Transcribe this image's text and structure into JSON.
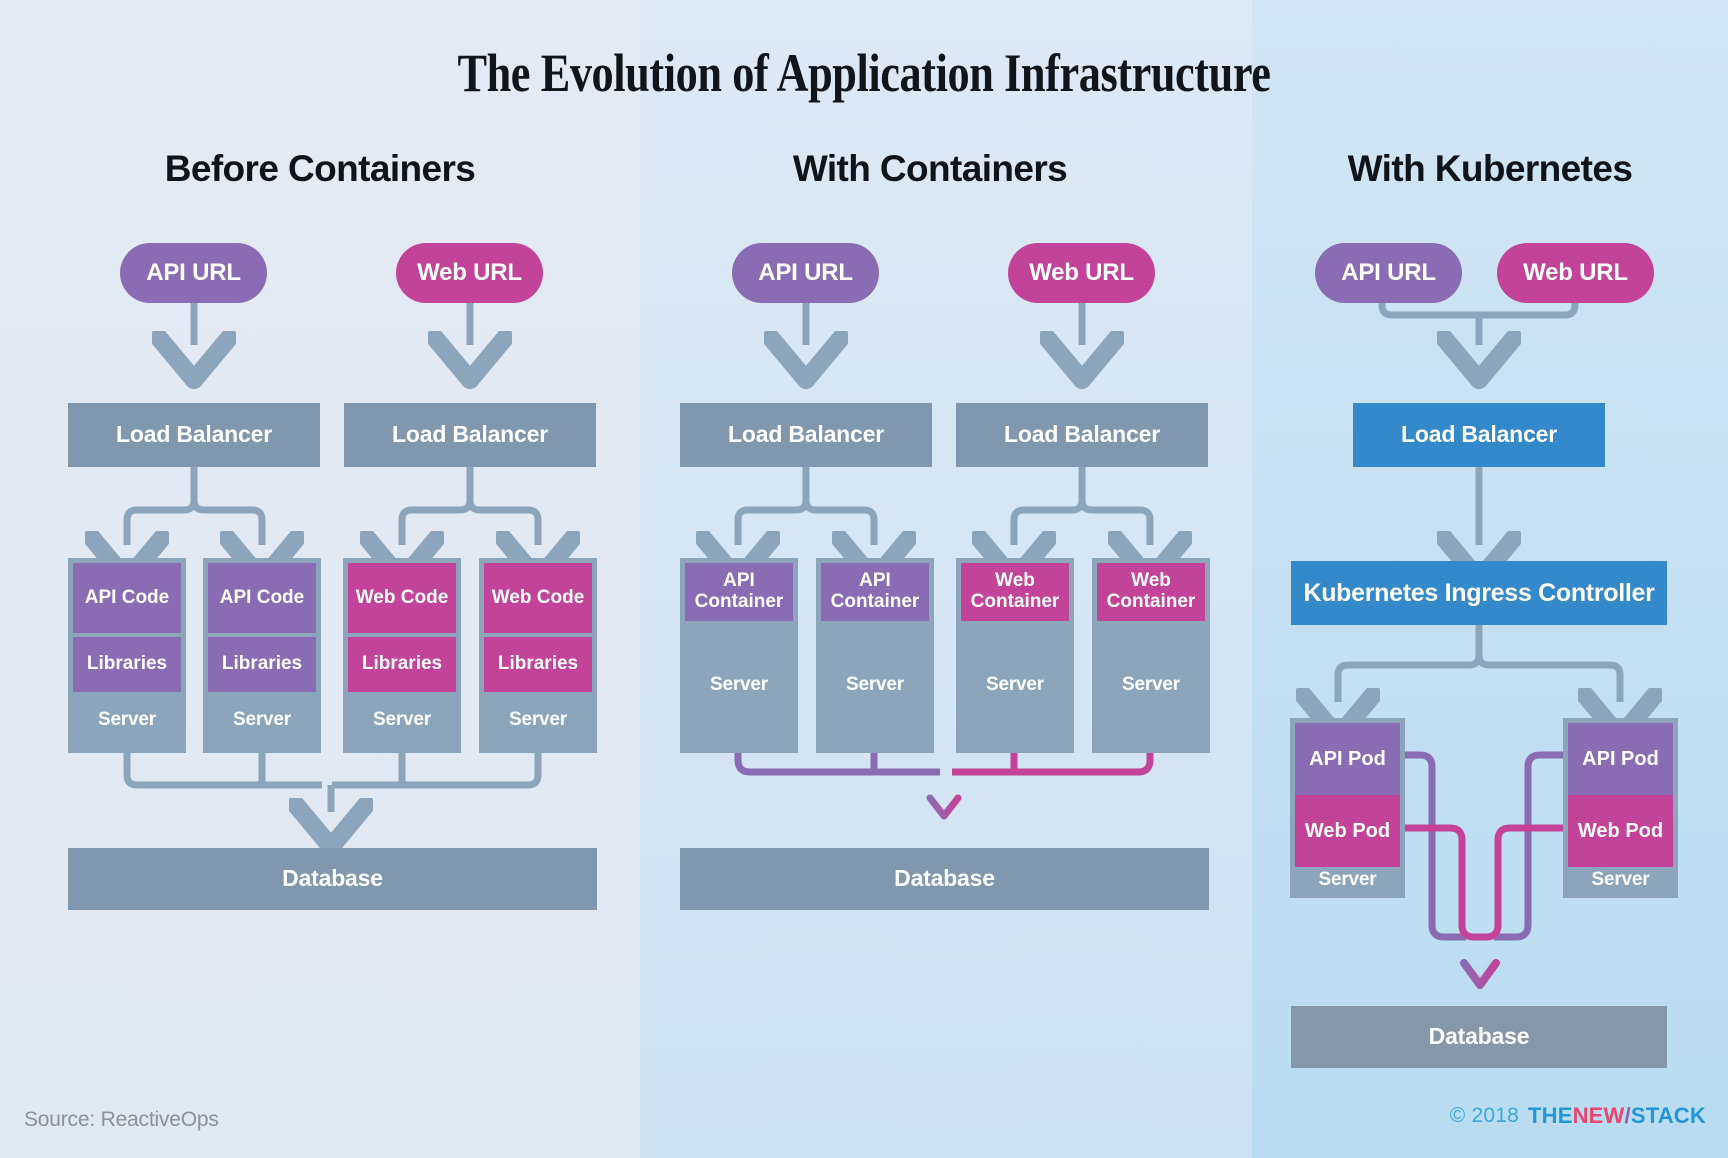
{
  "title": "The Evolution of Application Infrastructure",
  "colors": {
    "background": "#e3e9f2",
    "purple": "#8a6cb4",
    "pink": "#c4439a",
    "slate": "#8097ae",
    "server_frame": "#8ca5bb",
    "blue": "#3489ca",
    "wire": "#8ca5bb",
    "brand_blue": "#2196d8",
    "brand_pink": "#e8466e"
  },
  "columns": [
    {
      "id": "before-containers",
      "heading": "Before Containers",
      "entry_points": [
        {
          "label": "API URL",
          "color": "purple"
        },
        {
          "label": "Web URL",
          "color": "pink"
        }
      ],
      "load_balancers": [
        {
          "label": "Load Balancer"
        },
        {
          "label": "Load Balancer"
        }
      ],
      "servers": [
        {
          "layers": [
            "API Code",
            "Libraries"
          ],
          "base": "Server",
          "color": "purple"
        },
        {
          "layers": [
            "API Code",
            "Libraries"
          ],
          "base": "Server",
          "color": "purple"
        },
        {
          "layers": [
            "Web Code",
            "Libraries"
          ],
          "base": "Server",
          "color": "pink"
        },
        {
          "layers": [
            "Web Code",
            "Libraries"
          ],
          "base": "Server",
          "color": "pink"
        }
      ],
      "database": "Database"
    },
    {
      "id": "with-containers",
      "heading": "With Containers",
      "entry_points": [
        {
          "label": "API URL",
          "color": "purple"
        },
        {
          "label": "Web URL",
          "color": "pink"
        }
      ],
      "load_balancers": [
        {
          "label": "Load Balancer"
        },
        {
          "label": "Load Balancer"
        }
      ],
      "servers": [
        {
          "layers": [
            "API Container"
          ],
          "base": "Server",
          "color": "purple"
        },
        {
          "layers": [
            "API Container"
          ],
          "base": "Server",
          "color": "purple"
        },
        {
          "layers": [
            "Web Container"
          ],
          "base": "Server",
          "color": "pink"
        },
        {
          "layers": [
            "Web Container"
          ],
          "base": "Server",
          "color": "pink"
        }
      ],
      "database": "Database"
    },
    {
      "id": "with-kubernetes",
      "heading": "With Kubernetes",
      "entry_points": [
        {
          "label": "API URL",
          "color": "purple"
        },
        {
          "label": "Web URL",
          "color": "pink"
        }
      ],
      "load_balancers": [
        {
          "label": "Load Balancer"
        }
      ],
      "ingress": "Kubernetes Ingress Controller",
      "servers": [
        {
          "layers": [
            "API Pod",
            "Web Pod"
          ],
          "base": "Server",
          "color": "mixed"
        },
        {
          "layers": [
            "API Pod",
            "Web Pod"
          ],
          "base": "Server",
          "color": "mixed"
        }
      ],
      "database": "Database"
    }
  ],
  "footer": {
    "source": "Source: ReactiveOps",
    "copyright": "© 2018",
    "brand_the": "THE",
    "brand_new": "NEW",
    "brand_slash": "/",
    "brand_stack": "STACK"
  }
}
